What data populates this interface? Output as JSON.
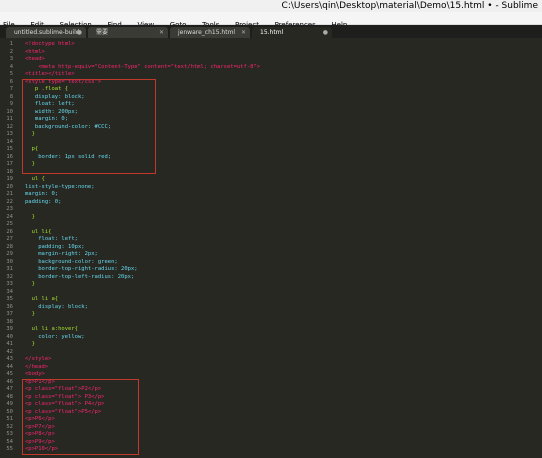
{
  "window": {
    "title": "C:\\Users\\qin\\Desktop\\material\\Demo\\15.html • - Sublime"
  },
  "menu": [
    "File",
    "Edit",
    "Selection",
    "Find",
    "View",
    "Goto",
    "Tools",
    "Project",
    "Preferences",
    "Help"
  ],
  "tabs": [
    {
      "label": "untitled.sublime-build"
    },
    {
      "label": "需要"
    },
    {
      "label": "jenware_ch15.html"
    },
    {
      "label": "15.html"
    }
  ],
  "lines": [
    {
      "n": "1",
      "text": "<!doctype html>"
    },
    {
      "n": "2",
      "text": "<html>"
    },
    {
      "n": "3",
      "text": "<head>"
    },
    {
      "n": "4",
      "text": "    <meta http-equiv=\"Content-Type\" content=\"text/html; charset=utf-8\">"
    },
    {
      "n": "5",
      "text": "<title></title>"
    },
    {
      "n": "6",
      "text": "<style type=\"text/css\">"
    },
    {
      "n": "7",
      "text": "   p .float {"
    },
    {
      "n": "8",
      "text": "   display: block;"
    },
    {
      "n": "9",
      "text": "   float: left;"
    },
    {
      "n": "10",
      "text": "   width: 200px;"
    },
    {
      "n": "11",
      "text": "   margin: 0;"
    },
    {
      "n": "12",
      "text": "   background-color: #CCC;"
    },
    {
      "n": "13",
      "text": "  }"
    },
    {
      "n": "14",
      "text": ""
    },
    {
      "n": "15",
      "text": "  p{"
    },
    {
      "n": "16",
      "text": "    border: 1px solid red;"
    },
    {
      "n": "17",
      "text": "  }"
    },
    {
      "n": "18",
      "text": ""
    },
    {
      "n": "19",
      "text": "  ul {"
    },
    {
      "n": "20",
      "text": "list-style-type:none;"
    },
    {
      "n": "21",
      "text": "margin: 0;"
    },
    {
      "n": "22",
      "text": "padding: 0;"
    },
    {
      "n": "23",
      "text": ""
    },
    {
      "n": "24",
      "text": "  }"
    },
    {
      "n": "25",
      "text": ""
    },
    {
      "n": "26",
      "text": "  ul li{"
    },
    {
      "n": "27",
      "text": "    float: left;"
    },
    {
      "n": "28",
      "text": "    padding: 10px;"
    },
    {
      "n": "29",
      "text": "    margin-right: 2px;"
    },
    {
      "n": "30",
      "text": "    background-color: green;"
    },
    {
      "n": "31",
      "text": "    border-top-right-radius: 20px;"
    },
    {
      "n": "32",
      "text": "    border-top-left-radius: 20px;"
    },
    {
      "n": "33",
      "text": "  }"
    },
    {
      "n": "34",
      "text": ""
    },
    {
      "n": "35",
      "text": "  ul li a{"
    },
    {
      "n": "36",
      "text": "    display: block;"
    },
    {
      "n": "37",
      "text": "  }"
    },
    {
      "n": "38",
      "text": ""
    },
    {
      "n": "39",
      "text": "  ul li a:hover{"
    },
    {
      "n": "40",
      "text": "    color: yellow;"
    },
    {
      "n": "41",
      "text": "  }"
    },
    {
      "n": "42",
      "text": ""
    },
    {
      "n": "43",
      "text": "</style>"
    },
    {
      "n": "44",
      "text": "</head>"
    },
    {
      "n": "45",
      "text": "<body>"
    },
    {
      "n": "46",
      "text": "<p>P1</p>"
    },
    {
      "n": "47",
      "text": "<p class=\"float\">P2</p>"
    },
    {
      "n": "48",
      "text": "<p class=\"float\"> P3</p>"
    },
    {
      "n": "49",
      "text": "<p class=\"float\"> P4</p>"
    },
    {
      "n": "50",
      "text": "<p class=\"float\">P5</p>"
    },
    {
      "n": "51",
      "text": "<p>P6</p>"
    },
    {
      "n": "52",
      "text": "<p>P7</p>"
    },
    {
      "n": "53",
      "text": "<p>P8</p>"
    },
    {
      "n": "54",
      "text": "<p>P9</p>"
    },
    {
      "n": "55",
      "text": "<p>P10</p>"
    }
  ]
}
